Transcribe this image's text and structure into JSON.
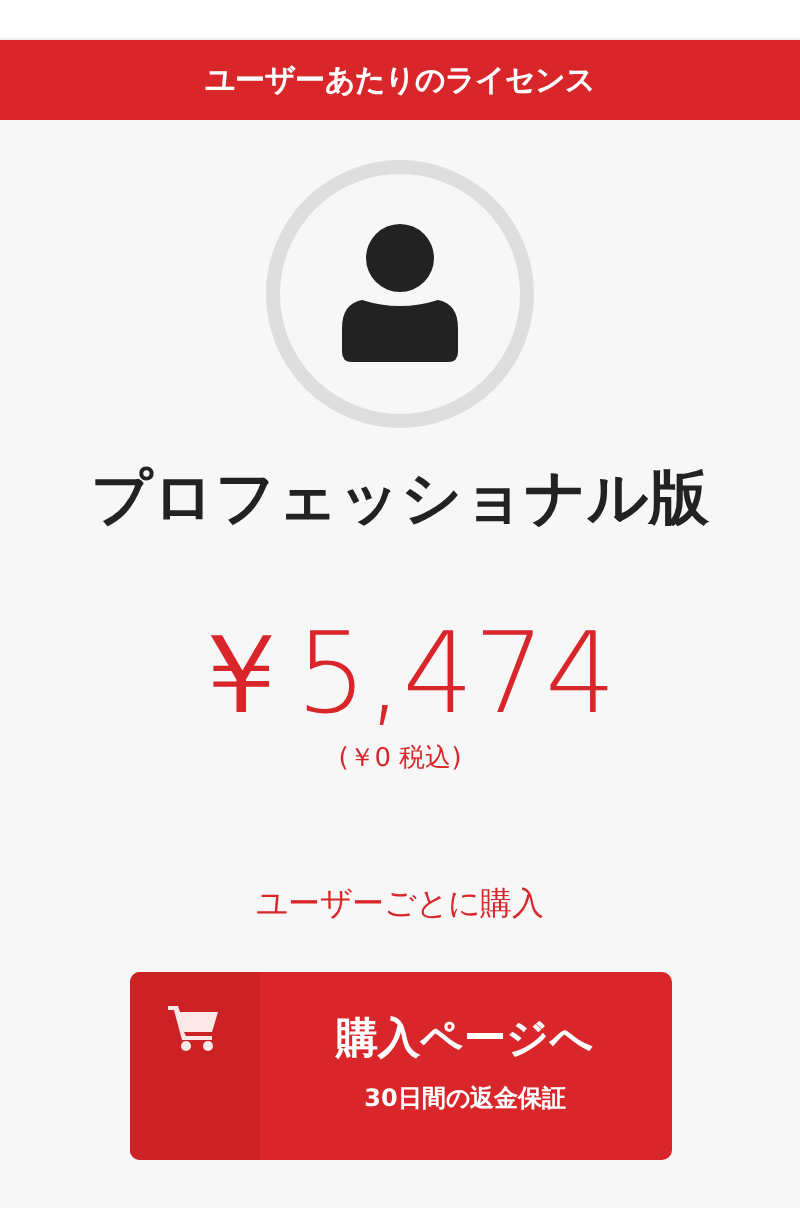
{
  "banner": {
    "title": "ユーザーあたりのライセンス"
  },
  "plan": {
    "name": "プロフェッショナル版"
  },
  "price": {
    "amount": "￥5,474",
    "tax_note": "(￥0 税込)"
  },
  "per_user_note": "ユーザーごとに購入",
  "purchase_button": {
    "label": "購入ページへ",
    "subtitle": "30日間の返金保証"
  }
}
